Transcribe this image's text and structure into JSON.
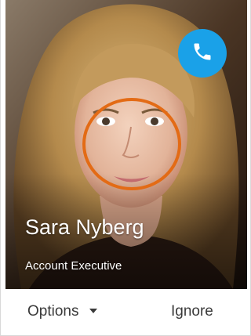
{
  "caller": {
    "name": "Sara Nyberg",
    "title": "Account Executive",
    "photo_icon": "contact-photo"
  },
  "call_button": {
    "icon": "phone-icon",
    "color": "#1aa1e8"
  },
  "highlight": {
    "color": "#e36b15"
  },
  "actions": {
    "options_label": "Options",
    "options_icon": "chevron-down-icon",
    "ignore_label": "Ignore"
  }
}
